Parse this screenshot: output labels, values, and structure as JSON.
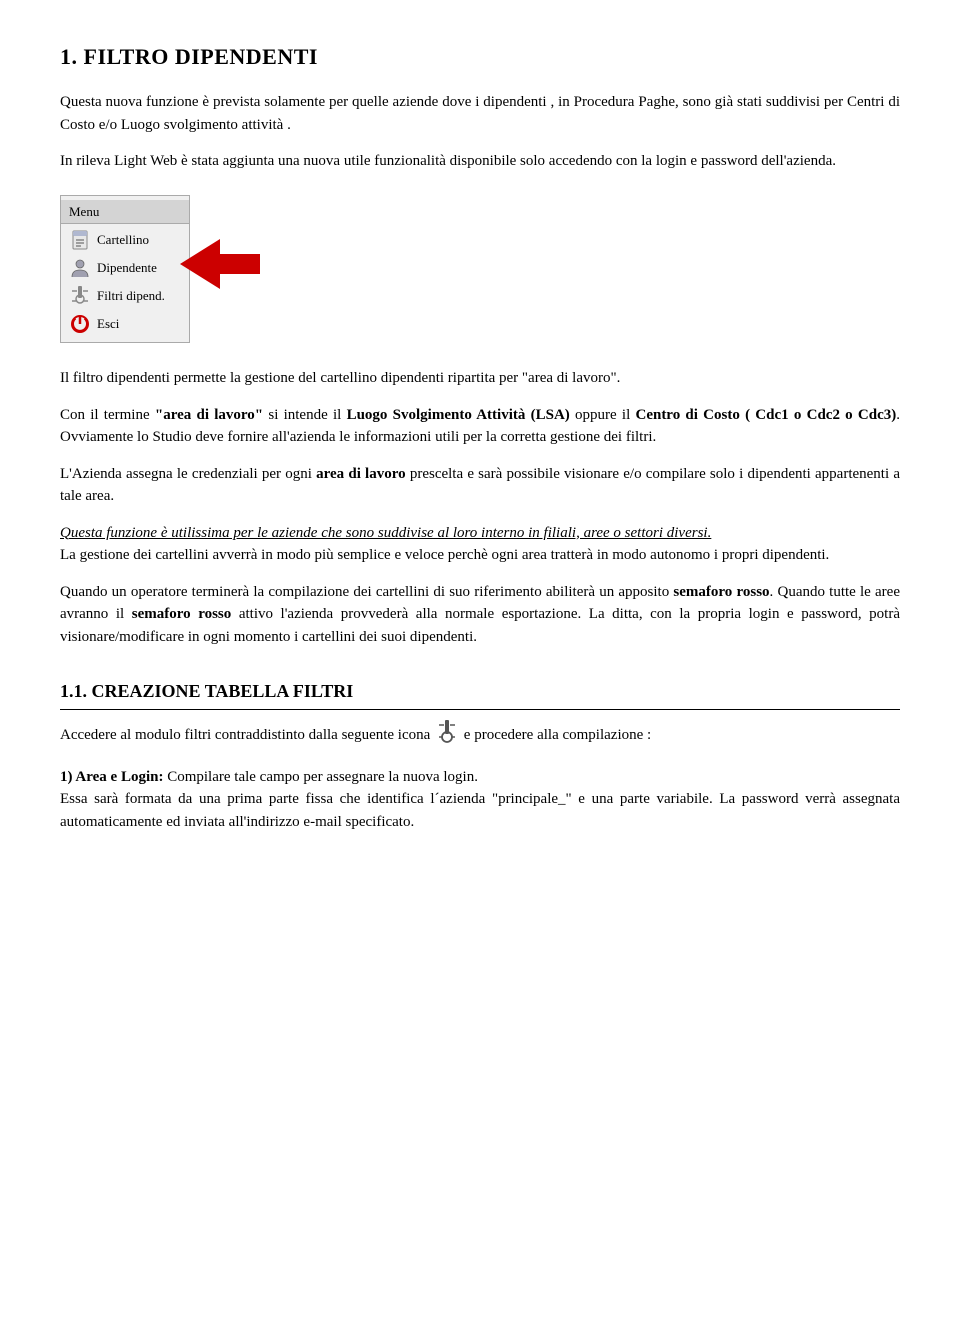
{
  "page": {
    "title": "1.   FILTRO DIPENDENTI",
    "intro_p1": "Questa nuova funzione è prevista solamente per quelle aziende dove i dipendenti , in Procedura Paghe, sono già stati suddivisi per Centri di Costo e/o Luogo svolgimento attività .",
    "intro_p2": "In rileva Light Web è stata aggiunta una nuova utile funzionalità disponibile solo accedendo con la login e password dell'azienda.",
    "menu": {
      "title": "Menu",
      "items": [
        {
          "label": "Cartellino",
          "icon": "document-icon"
        },
        {
          "label": "Dipendente",
          "icon": "person-icon"
        },
        {
          "label": "Filtri dipend.",
          "icon": "filter-icon"
        },
        {
          "label": "Esci",
          "icon": "power-icon"
        }
      ]
    },
    "p_filtro": "Il filtro dipendenti permette la gestione del cartellino dipendenti ripartita per \"area di lavoro\".",
    "p_con": "Con il termine \"area di lavoro\" si intende il Luogo Svolgimento Attività (LSA) oppure il Centro di Costo ( Cdc1 o Cdc2 o Cdc3). Ovviamente lo Studio deve fornire all'azienda le informazioni utili per la corretta gestione dei filtri.",
    "p_azienda": "L'Azienda assegna le credenziali  per ogni area di lavoro prescelta e sarà possibile visionare e/o compilare solo i dipendenti appartenenti a tale area.",
    "p_utilissima": "Questa funzione è utilissima per le aziende che sono suddivise al loro interno in filiali, aree o settori diversi.\nLa gestione dei cartellini avverrà in modo più semplice e veloce perchè ogni area tratterà in modo autonomo i propri dipendenti.",
    "p_quando": "Quando un operatore terminerà la compilazione dei cartellini di suo riferimento abiliterà un apposito semaforo rosso. Quando tutte le aree avranno il semaforo rosso attivo l'azienda provvederà alla normale esportazione. La ditta, con la propria login e password, potrà visionare/modificare in ogni momento i cartellini dei suoi dipendenti.",
    "subsection_title": "1.1.   CREAZIONE TABELLA FILTRI",
    "p_accedere": "Accedere al modulo filtri contraddistinto dalla seguente icona",
    "p_accedere2": "e procedere alla compilazione :",
    "p_area_login_label": "1) Area e Login:",
    "p_area_login_text": "Compilare tale campo per assegnare la nuova login.\nEssa sarà formata da una prima parte fissa che identifica l´azienda \"principale_\" e una parte variabile. La password verrà assegnata automaticamente ed inviata all'indirizzo e-mail specificato."
  }
}
